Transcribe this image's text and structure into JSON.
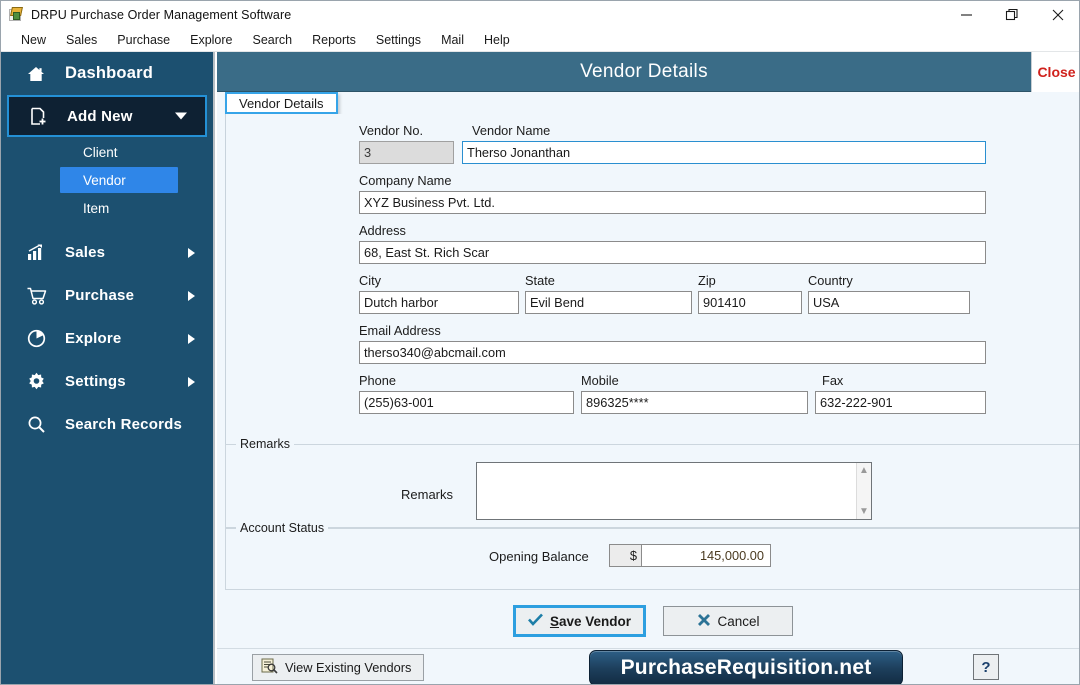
{
  "window": {
    "title": "DRPU Purchase Order Management Software",
    "icon": "app-icon",
    "controls": {
      "minimize": "minimize-icon",
      "maximize": "maximize-icon",
      "close": "close-icon"
    }
  },
  "menubar": {
    "items": [
      "New",
      "Sales",
      "Purchase",
      "Explore",
      "Search",
      "Reports",
      "Settings",
      "Mail",
      "Help"
    ]
  },
  "sidebar": {
    "items": [
      {
        "label": "Dashboard",
        "icon": "home-icon",
        "arrow": ""
      },
      {
        "label": "Add New",
        "icon": "add-document-icon",
        "arrow": "chevron-down-icon"
      },
      {
        "label": "Sales",
        "icon": "bar-chart-icon",
        "arrow": "chevron-right-icon"
      },
      {
        "label": "Purchase",
        "icon": "shopping-cart-icon",
        "arrow": "chevron-right-icon"
      },
      {
        "label": "Explore",
        "icon": "pie-chart-icon",
        "arrow": "chevron-right-icon"
      },
      {
        "label": "Settings",
        "icon": "gear-icon",
        "arrow": "chevron-right-icon"
      },
      {
        "label": "Search Records",
        "icon": "magnifier-icon",
        "arrow": ""
      }
    ],
    "subitems": [
      {
        "label": "Client",
        "selected": false
      },
      {
        "label": "Vendor",
        "selected": true
      },
      {
        "label": "Item",
        "selected": false
      }
    ]
  },
  "form": {
    "header_title": "Vendor Details",
    "close_label": "Close",
    "tab_label": "Vendor Details",
    "fields": {
      "vendor_no_label": "Vendor No.",
      "vendor_no_value": "3",
      "vendor_name_label": "Vendor Name",
      "vendor_name_value": "Therso Jonanthan",
      "company_name_label": "Company Name",
      "company_name_value": "XYZ Business Pvt. Ltd.",
      "address_label": "Address",
      "address_value": "68, East St. Rich Scar",
      "city_label": "City",
      "city_value": "Dutch harbor",
      "state_label": "State",
      "state_value": "Evil Bend",
      "zip_label": "Zip",
      "zip_value": "901410",
      "country_label": "Country",
      "country_value": "USA",
      "email_label": "Email Address",
      "email_value": "therso340@abcmail.com",
      "phone_label": "Phone",
      "phone_value": "(255)63-001",
      "mobile_label": "Mobile",
      "mobile_value": "896325****",
      "fax_label": "Fax",
      "fax_value": "632-222-901"
    },
    "remarks": {
      "group_title": "Remarks",
      "field_label": "Remarks",
      "value": ""
    },
    "account_status": {
      "group_title": "Account Status",
      "opening_balance_label": "Opening Balance",
      "currency_symbol": "$",
      "opening_balance_value": "145,000.00"
    },
    "buttons": {
      "save_accel": "S",
      "save_rest": "ave Vendor",
      "save_icon": "check-icon",
      "cancel_label": "Cancel",
      "cancel_icon": "cross-icon"
    }
  },
  "footer": {
    "view_existing_label": "View Existing Vendors",
    "view_existing_icon": "document-search-icon",
    "brand_label": "PurchaseRequisition.net",
    "help_label": "?",
    "help_icon": "question-mark-icon"
  },
  "colors": {
    "sidebar_bg": "#1c5070",
    "sidebar_active": "#0e2133",
    "accent_blue": "#2f86e8",
    "header_bg": "#3a6c87",
    "close_red": "#d0211c",
    "panel_bg": "#f1f7fc"
  }
}
